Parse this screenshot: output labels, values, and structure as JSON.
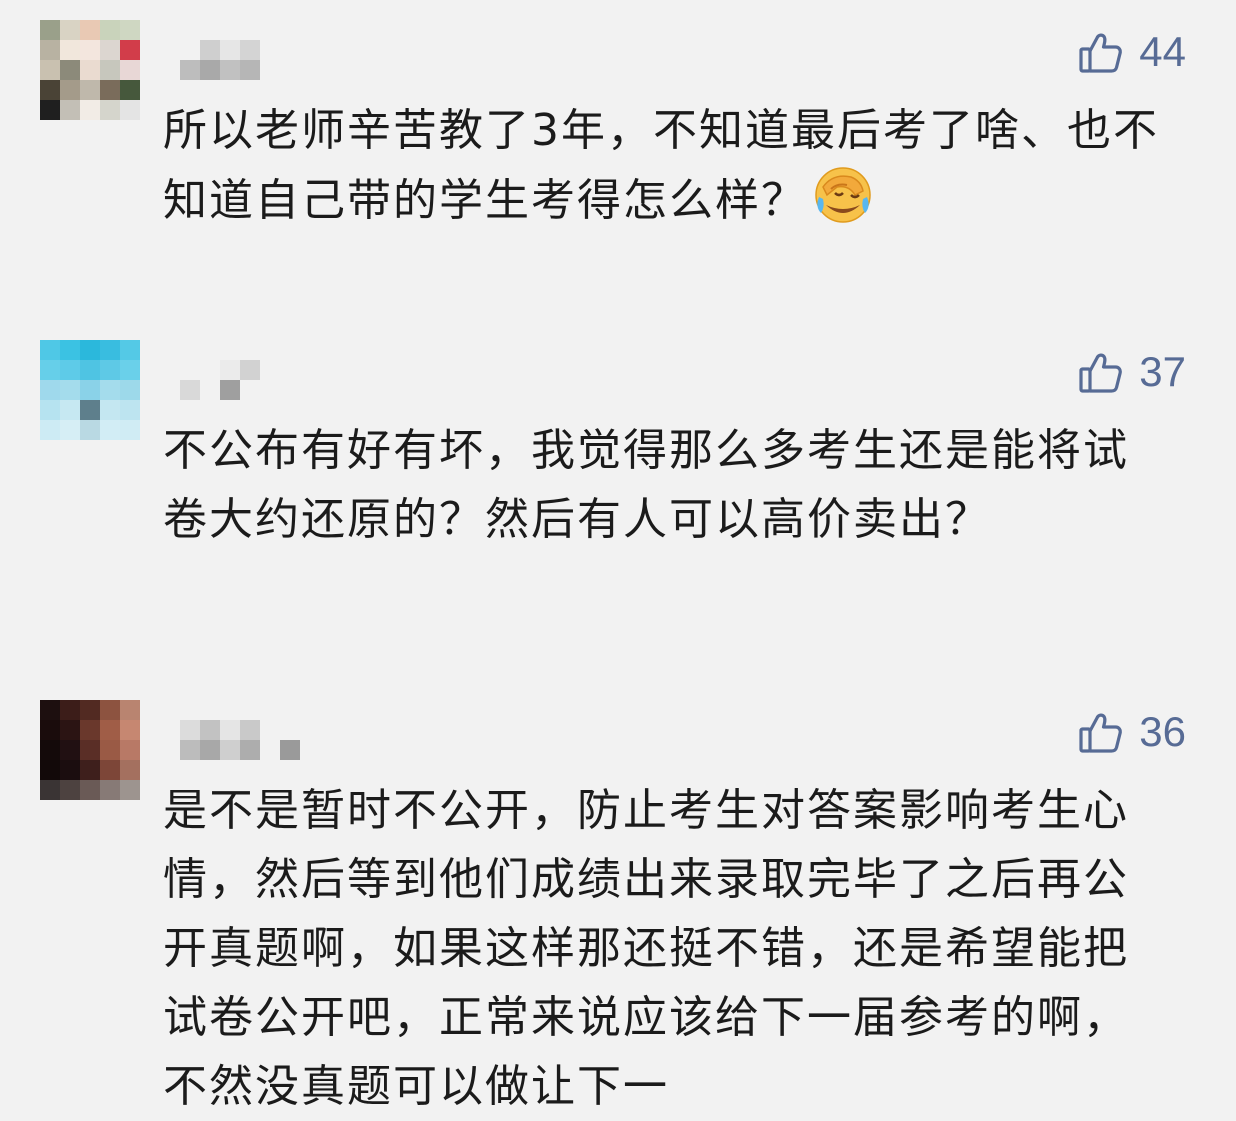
{
  "comments": [
    {
      "likes": "44",
      "text": "所以老师辛苦教了3年，不知道最后考了啥、也不知道自己带的学生考得怎么样？",
      "emoji": "face-palm-crying-emoji",
      "avatar_colors": [
        "#9aa08a",
        "#d9d3c4",
        "#e9c9b4",
        "#c9d3bb",
        "#cfd7c2",
        "#b8b2a2",
        "#f1e7dc",
        "#f3e6de",
        "#dcd6d0",
        "#d23d4a",
        "#c9c1b0",
        "#8c8a7a",
        "#eadbd0",
        "#c7c7bd",
        "#e8d7d6",
        "#4a4336",
        "#a49b8a",
        "#bfb8ab",
        "#7a6c5b",
        "#46583c",
        "#1f1f1f",
        "#c3bfb6",
        "#f2ece6",
        "#d5d5cc",
        "#e4e4e4"
      ],
      "username_colors": [
        "#f2f2f2",
        "#cfcfcf",
        "#e6e6e6",
        "#d4d4d4",
        "#f2f2f2",
        "#f2f2f2",
        "#f2f2f2",
        "#f2f2f2",
        "#bdbdbd",
        "#a9a9a9",
        "#c1c1c1",
        "#b6b6b6",
        "#f2f2f2",
        "#f2f2f2",
        "#f2f2f2",
        "#f2f2f2"
      ]
    },
    {
      "likes": "37",
      "text": "不公布有好有坏，我觉得那么多考生还是能将试卷大约还原的？然后有人可以高价卖出？",
      "emoji": "",
      "avatar_colors": [
        "#4fc8e6",
        "#3bc2e3",
        "#2bb8dc",
        "#39bde0",
        "#54c9e6",
        "#66cfe9",
        "#5ecbe8",
        "#4fc4e3",
        "#5ec9e6",
        "#6ad0ea",
        "#9fd9ec",
        "#a4dcec",
        "#8ad2e8",
        "#a4dcec",
        "#9dd9ea",
        "#b6e3f0",
        "#c6e8f2",
        "#5e7f8c",
        "#c4e7f1",
        "#bde4f0",
        "#cdebf4",
        "#d6eef5",
        "#b9d9e3",
        "#d2edf5",
        "#d0ecf4"
      ],
      "username_colors": [
        "#f2f2f2",
        "#f2f2f2",
        "#ebebeb",
        "#d2d2d2",
        "#f2f2f2",
        "#f2f2f2",
        "#f2f2f2",
        "#f2f2f2",
        "#d9d9d9",
        "#f2f2f2",
        "#9f9f9f",
        "#f2f2f2",
        "#f2f2f2",
        "#f2f2f2",
        "#f2f2f2",
        "#f2f2f2"
      ]
    },
    {
      "likes": "36",
      "text": "是不是暂时不公开，防止考生对答案影响考生心情，然后等到他们成绩出来录取完毕了之后再公开真题啊，如果这样那还挺不错，还是希望能把试卷公开吧，正常来说应该给下一届参考的啊，不然没真题可以做让下一",
      "emoji": "",
      "avatar_colors": [
        "#1d0f0f",
        "#3c1d19",
        "#522a22",
        "#8d5340",
        "#b98470",
        "#1a0c0c",
        "#2b1413",
        "#6a382c",
        "#a05d47",
        "#c68771",
        "#140a0a",
        "#211012",
        "#5a2e26",
        "#9a5a45",
        "#b87966",
        "#120909",
        "#1b0d0f",
        "#3e1f1c",
        "#7d4638",
        "#a4705f",
        "#3a3434",
        "#4d4240",
        "#6a5a56",
        "#877a76",
        "#9d948f"
      ],
      "username_colors": [
        "#dcdcdc",
        "#c2c2c2",
        "#e5e5e5",
        "#c9c9c9",
        "#f2f2f2",
        "#f2f2f2",
        "#f2f2f2",
        "#f2f2f2",
        "#bcbcbc",
        "#a8a8a8",
        "#cfcfcf",
        "#adadad",
        "#f2f2f2",
        "#9a9a9a",
        "#f2f2f2",
        "#f2f2f2"
      ]
    }
  ],
  "colors": {
    "like_accent": "#576b95",
    "background": "#f2f2f2",
    "text": "#1b1b1b"
  }
}
